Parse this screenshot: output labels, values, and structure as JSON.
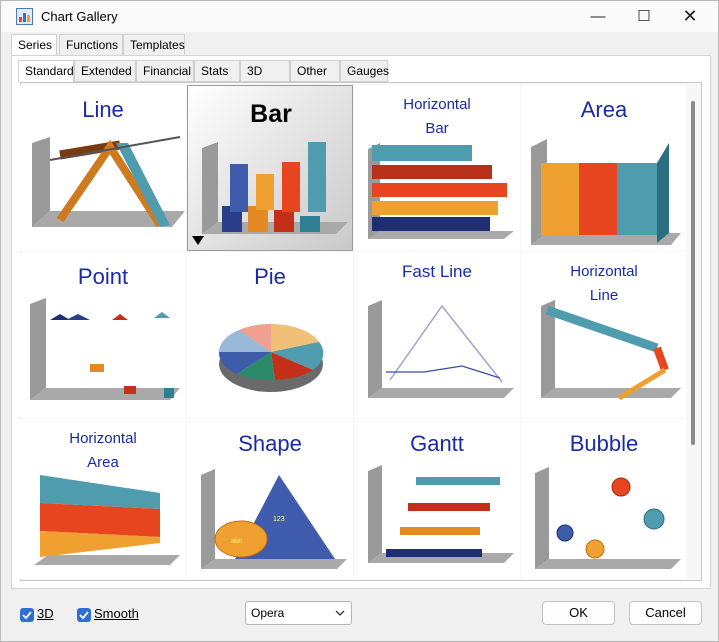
{
  "window": {
    "title": "Chart Gallery"
  },
  "window_controls": {
    "minimize": "—",
    "maximize": "☐",
    "close": "✕"
  },
  "top_tabs": [
    {
      "label": "Series",
      "active": true
    },
    {
      "label": "Functions",
      "active": false
    },
    {
      "label": "Templates",
      "active": false
    }
  ],
  "sub_tabs": [
    {
      "label": "Standard",
      "active": true
    },
    {
      "label": "Extended",
      "active": false
    },
    {
      "label": "Financial",
      "active": false
    },
    {
      "label": "Stats",
      "active": false
    },
    {
      "label": "3D",
      "active": false
    },
    {
      "label": "Other",
      "active": false
    },
    {
      "label": "Gauges",
      "active": false
    }
  ],
  "gallery": {
    "selected": "Bar",
    "items": [
      {
        "title": "Line"
      },
      {
        "title": "Bar"
      },
      {
        "title": "Horizontal Bar",
        "line1": "Horizontal",
        "line2": "Bar"
      },
      {
        "title": "Area"
      },
      {
        "title": "Point"
      },
      {
        "title": "Pie"
      },
      {
        "title": "Fast Line"
      },
      {
        "title": "Horizontal Line",
        "line1": "Horizontal",
        "line2": "Line"
      },
      {
        "title": "Horizontal Area",
        "line1": "Horizontal",
        "line2": "Area"
      },
      {
        "title": "Shape"
      },
      {
        "title": "Gantt"
      },
      {
        "title": "Bubble"
      }
    ],
    "shape_labels": {
      "ellipse": "abc",
      "triangle": "123"
    }
  },
  "options": {
    "three_d": {
      "label": "3D",
      "checked": true
    },
    "smooth": {
      "label": "Smooth",
      "checked": true
    },
    "palette": {
      "value": "Opera"
    }
  },
  "buttons": {
    "ok": "OK",
    "cancel": "Cancel"
  },
  "colors": {
    "accent": "#2f6fd0",
    "title_blue": "#1a2aa8",
    "series_orange": "#f0a030",
    "series_red": "#e0401c",
    "series_teal": "#4a9aaa",
    "series_navy": "#1a2a6a"
  }
}
